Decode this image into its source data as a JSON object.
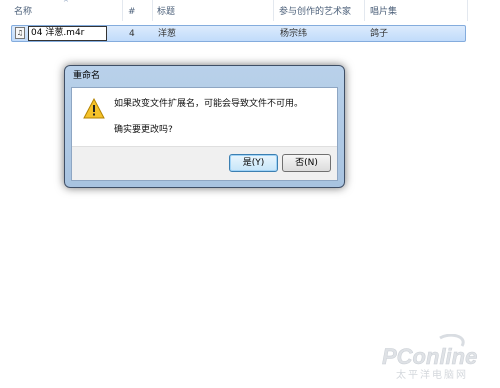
{
  "columns": [
    {
      "label": "名称"
    },
    {
      "label": "#"
    },
    {
      "label": "标题"
    },
    {
      "label": "参与创作的艺术家"
    },
    {
      "label": "唱片集"
    }
  ],
  "row": {
    "filename": "04 洋葱.m4r",
    "track": "4",
    "title": "洋葱",
    "artist": "杨宗纬",
    "album": "鸽子"
  },
  "dialog": {
    "title": "重命名",
    "message": "如果改变文件扩展名，可能会导致文件不可用。",
    "question": "确实要更改吗?",
    "yes_label": "是(Y)",
    "no_label": "否(N)"
  },
  "icons": {
    "file": "music-file-icon",
    "warning": "warning-triangle-icon"
  },
  "watermark": {
    "brand": "PConline",
    "subtitle": "太平洋电脑网"
  }
}
